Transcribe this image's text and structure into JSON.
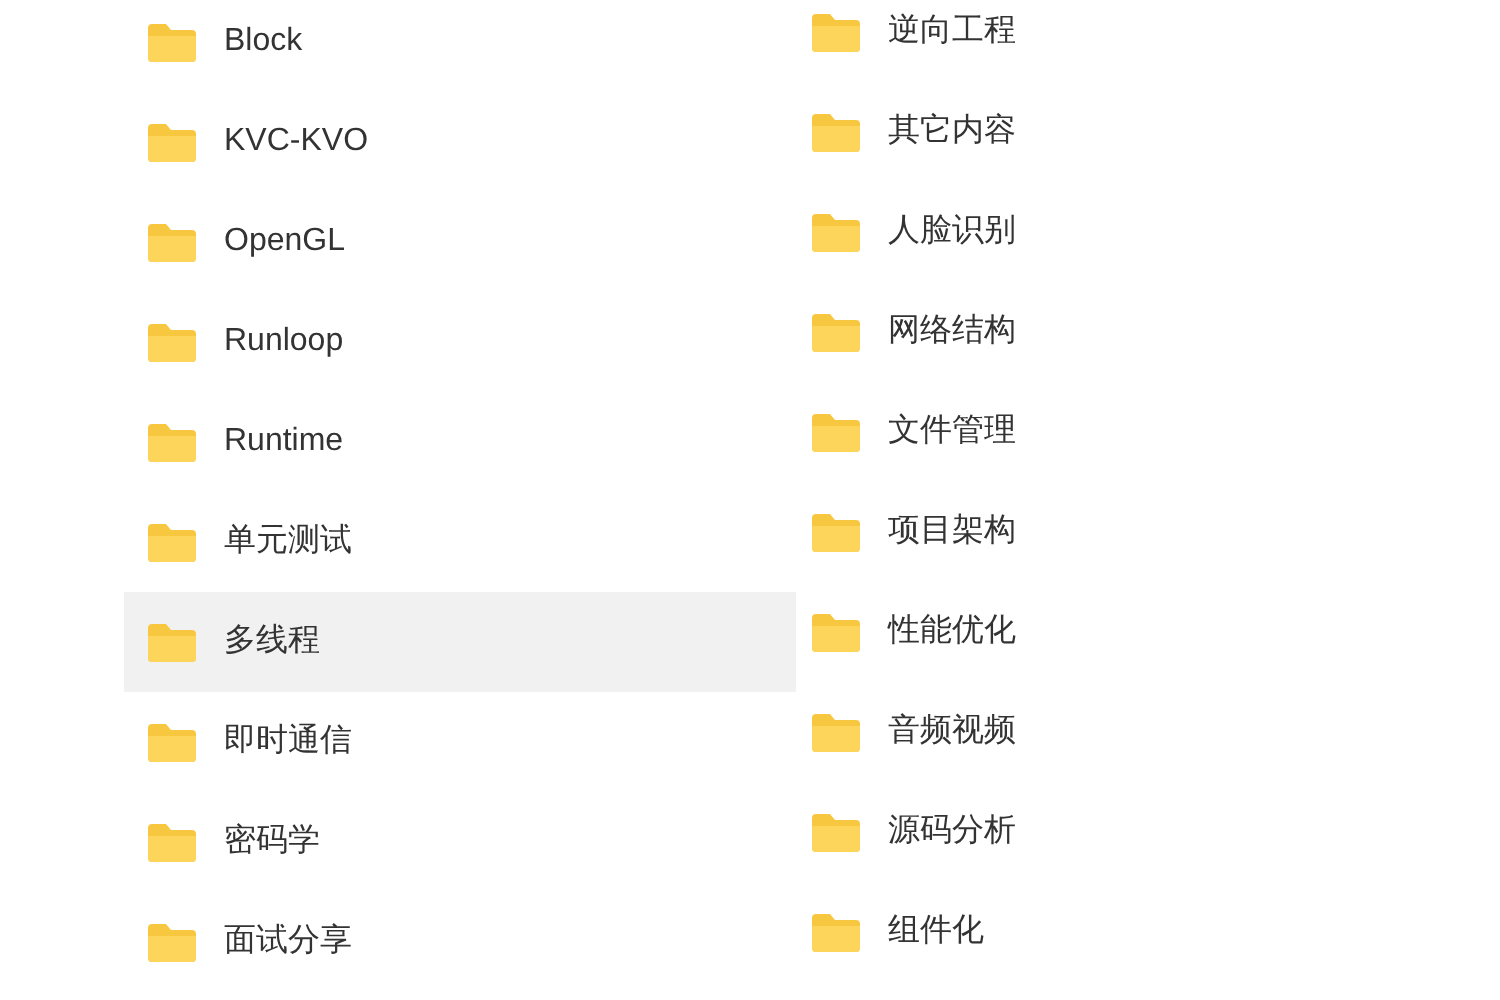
{
  "columns": [
    {
      "items": [
        {
          "name": "Block",
          "selected": false
        },
        {
          "name": "KVC-KVO",
          "selected": false
        },
        {
          "name": "OpenGL",
          "selected": false
        },
        {
          "name": "Runloop",
          "selected": false
        },
        {
          "name": "Runtime",
          "selected": false
        },
        {
          "name": "单元测试",
          "selected": false
        },
        {
          "name": "多线程",
          "selected": true
        },
        {
          "name": "即时通信",
          "selected": false
        },
        {
          "name": "密码学",
          "selected": false
        },
        {
          "name": "面试分享",
          "selected": false
        }
      ]
    },
    {
      "items": [
        {
          "name": "逆向工程",
          "selected": false
        },
        {
          "name": "其它内容",
          "selected": false
        },
        {
          "name": "人脸识别",
          "selected": false
        },
        {
          "name": "网络结构",
          "selected": false
        },
        {
          "name": "文件管理",
          "selected": false
        },
        {
          "name": "项目架构",
          "selected": false
        },
        {
          "name": "性能优化",
          "selected": false
        },
        {
          "name": "音频视频",
          "selected": false
        },
        {
          "name": "源码分析",
          "selected": false
        },
        {
          "name": "组件化",
          "selected": false
        }
      ]
    }
  ]
}
